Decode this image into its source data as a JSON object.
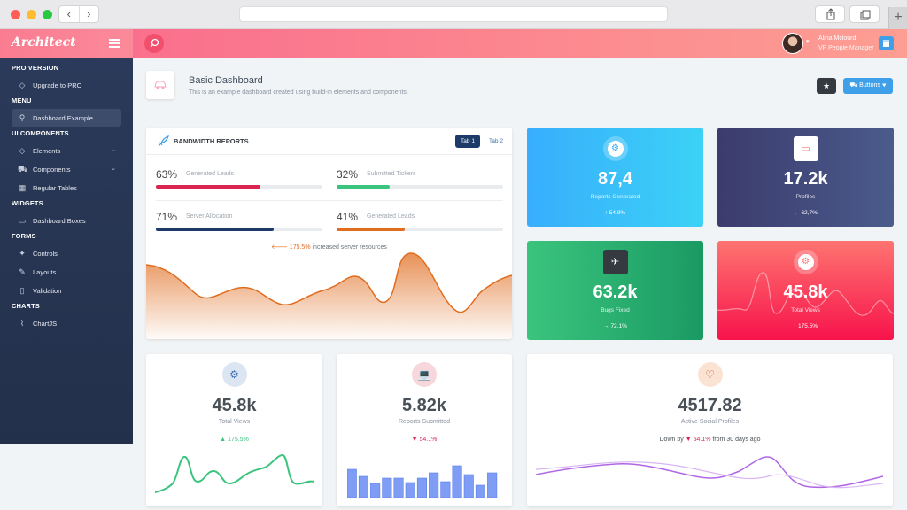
{
  "app": {
    "logo": "Architect"
  },
  "browser": {
    "back": "‹",
    "forward": "›",
    "new_tab": "+"
  },
  "header": {
    "user_name": "Alina Mclourd",
    "user_role": "VP People Manager"
  },
  "sidebar": {
    "sections": [
      {
        "title": "PRO VERSION",
        "items": [
          {
            "label": "Upgrade to PRO",
            "icon": "diamond-icon"
          }
        ]
      },
      {
        "title": "MENU",
        "items": [
          {
            "label": "Dashboard Example",
            "icon": "rocket-icon",
            "active": true
          }
        ]
      },
      {
        "title": "UI COMPONENTS",
        "items": [
          {
            "label": "Elements",
            "icon": "diamond-icon",
            "chevron": true
          },
          {
            "label": "Components",
            "icon": "car-icon",
            "chevron": true
          },
          {
            "label": "Regular Tables",
            "icon": "table-icon"
          }
        ]
      },
      {
        "title": "WIDGETS",
        "items": [
          {
            "label": "Dashboard Boxes",
            "icon": "display-icon"
          }
        ]
      },
      {
        "title": "FORMS",
        "items": [
          {
            "label": "Controls",
            "icon": "light-icon"
          },
          {
            "label": "Layouts",
            "icon": "eyedropper-icon"
          },
          {
            "label": "Validation",
            "icon": "pendrive-icon"
          }
        ]
      },
      {
        "title": "CHARTS",
        "items": [
          {
            "label": "ChartJS",
            "icon": "graph-icon"
          }
        ]
      }
    ]
  },
  "page": {
    "title": "Basic Dashboard",
    "subtitle": "This is an example dashboard created using build-in elements and components.",
    "buttons_label": "Buttons"
  },
  "bandwidth": {
    "title": "BANDWIDTH REPORTS",
    "tab1": "Tab 1",
    "tab2": "Tab 2",
    "progress": [
      {
        "pct": "63%",
        "label": "Generated Leads",
        "value": 0.63,
        "color": "#d92550"
      },
      {
        "pct": "32%",
        "label": "Submitted Tickers",
        "value": 0.32,
        "color": "#3ac47d"
      },
      {
        "pct": "71%",
        "label": "Server Allocation",
        "value": 0.71,
        "color": "#1d3b68"
      },
      {
        "pct": "41%",
        "label": "Generated Leads",
        "value": 0.41,
        "color": "#e06c1e"
      }
    ],
    "note_value": "175.5%",
    "note_text": "increased server resources",
    "chart_color": "#e06c1e"
  },
  "tiles": [
    {
      "value": "87,4",
      "label": "Reports Generated",
      "change": "54.9%",
      "change_arrow": "↑",
      "icon": "settings-icon",
      "color_start": "#38aefc",
      "color_end": "#3bd2f6"
    },
    {
      "value": "17.2k",
      "label": "Profiles",
      "change": "62,7%",
      "change_arrow": "←",
      "icon": "monitor-icon",
      "color_start": "#3c3b6d",
      "color_end": "#4a5b8c"
    },
    {
      "value": "63.2k",
      "label": "Bugs Fixed",
      "change": "72.1%",
      "change_arrow": "→",
      "icon": "graduation-cap-icon",
      "color_start": "#3ac47d",
      "color_end": "#1a9a63"
    },
    {
      "value": "45.8k",
      "label": "Total Views",
      "change": "175.5%",
      "change_arrow": "↑",
      "icon": "settings-icon",
      "color_start": "#fe7470",
      "color_end": "#f7134b"
    }
  ],
  "bottom": [
    {
      "value": "45.8k",
      "label": "Total Views",
      "change": "175.5%",
      "change_arrow": "▲",
      "change_color": "#3ac47d",
      "icon": "settings-icon",
      "icon_bg": "#dce6f3",
      "icon_color": "#3f6fb0",
      "chart": "line",
      "chart_color": "#3ac47d"
    },
    {
      "value": "5.82k",
      "label": "Reports Submitted",
      "change": "54.1%",
      "change_arrow": "▼",
      "change_color": "#d92550",
      "icon": "laptop-icon",
      "icon_bg": "#f8d7dc",
      "icon_color": "#d92550",
      "chart": "bar",
      "chart_color": "#7f9df5"
    },
    {
      "value": "4517.82",
      "label": "Active Social Profiles",
      "prefix": "Down by",
      "change": "54.1%",
      "change_arrow": "▼",
      "suffix": "from 30 days ago",
      "change_color": "#d92550",
      "icon": "heart-icon",
      "icon_bg": "#fbe3d3",
      "icon_color": "#c0603b",
      "chart": "line2",
      "chart_color": "#b066e6"
    }
  ]
}
